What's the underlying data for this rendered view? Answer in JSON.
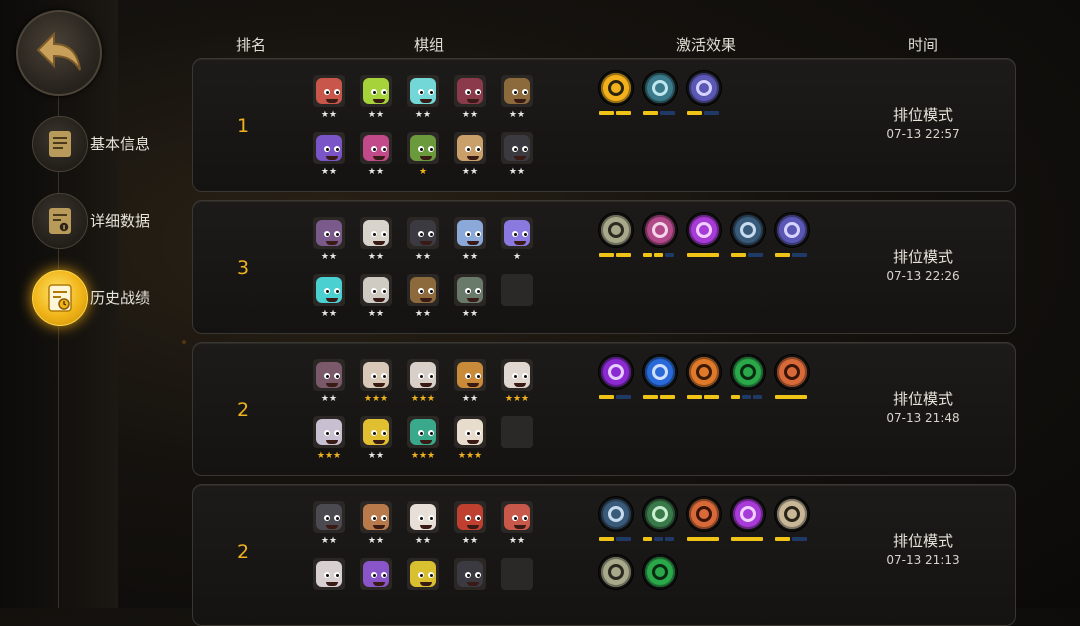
{
  "sidebar": {
    "back_icon": "back-arrow-icon",
    "items": [
      {
        "label": "基本信息",
        "icon": "document-icon",
        "active": false
      },
      {
        "label": "详细数据",
        "icon": "data-sheet-icon",
        "active": false
      },
      {
        "label": "历史战绩",
        "icon": "history-clock-icon",
        "active": true
      }
    ]
  },
  "headers": {
    "rank": "排名",
    "lineup": "棋组",
    "traits": "激活效果",
    "time": "时间"
  },
  "colors": {
    "accent": "#f0b21e",
    "star_gold": "#f0b21e",
    "star_white": "#e6e6e6",
    "bar_on": "#f0c417",
    "bar_off": "#1f3a66"
  },
  "matches": [
    {
      "rank": "1",
      "mode": "排位模式",
      "time": "07-13 22:57",
      "pieces": [
        {
          "color": "#c9564a",
          "stars": "★★",
          "star_color": "white"
        },
        {
          "color": "#a6d23a",
          "stars": "★★",
          "star_color": "white"
        },
        {
          "color": "#72d7d6",
          "stars": "★★",
          "star_color": "white"
        },
        {
          "color": "#8a3a4a",
          "stars": "★★",
          "star_color": "white"
        },
        {
          "color": "#8c6a3c",
          "stars": "★★",
          "star_color": "white"
        },
        {
          "color": "#7a55c8",
          "stars": "★★",
          "star_color": "white"
        },
        {
          "color": "#c24a8a",
          "stars": "★★",
          "star_color": "white"
        },
        {
          "color": "#6a9a3c",
          "stars": "★",
          "star_color": "gold"
        },
        {
          "color": "#c9a06a",
          "stars": "★★",
          "star_color": "white"
        },
        {
          "color": "#3a3a40",
          "stars": "★★",
          "star_color": "white"
        }
      ],
      "traits": [
        {
          "icon": "keyhole-trait-icon",
          "bg": "#f2b01c",
          "fg": "#2a2410",
          "bars": [
            1,
            1
          ]
        },
        {
          "icon": "mystery-trait-icon",
          "bg": "#3a7a8a",
          "fg": "#bfe6ef",
          "bars": [
            1,
            0
          ]
        },
        {
          "icon": "mech-trait-icon",
          "bg": "#5a58b4",
          "fg": "#d6d4ff",
          "bars": [
            1,
            0
          ]
        }
      ]
    },
    {
      "rank": "3",
      "mode": "排位模式",
      "time": "07-13 22:26",
      "pieces": [
        {
          "color": "#7a5a8a",
          "stars": "★★",
          "star_color": "white"
        },
        {
          "color": "#d8d4cc",
          "stars": "★★",
          "star_color": "white"
        },
        {
          "color": "#3a3a40",
          "stars": "★★",
          "star_color": "white"
        },
        {
          "color": "#8aa8d8",
          "stars": "★★",
          "star_color": "white"
        },
        {
          "color": "#8a7ae0",
          "stars": "★",
          "star_color": "white"
        },
        {
          "color": "#4ad0d0",
          "stars": "★★",
          "star_color": "white"
        },
        {
          "color": "#cfcac2",
          "stars": "★★",
          "star_color": "white"
        },
        {
          "color": "#8c6a3c",
          "stars": "★★",
          "star_color": "white"
        },
        {
          "color": "#6a7a6a",
          "stars": "★★",
          "star_color": "white"
        },
        {
          "color": "",
          "stars": "",
          "star_color": "white"
        }
      ],
      "traits": [
        {
          "icon": "beast-trait-icon",
          "bg": "#a8a88a",
          "fg": "#2a2a20",
          "bars": [
            1,
            1
          ]
        },
        {
          "icon": "knight-trait-icon",
          "bg": "#b24a8a",
          "fg": "#f3d6ea",
          "bars": [
            1,
            1,
            0
          ]
        },
        {
          "icon": "demon-trait-icon",
          "bg": "#a83ad8",
          "fg": "#f0d0ff",
          "bars": [
            2
          ]
        },
        {
          "icon": "orb-trait-icon",
          "bg": "#3a5a7a",
          "fg": "#c8dcf0",
          "bars": [
            1,
            0
          ]
        },
        {
          "icon": "mech-trait-icon",
          "bg": "#5a58b4",
          "fg": "#d6d4ff",
          "bars": [
            1,
            0
          ]
        }
      ]
    },
    {
      "rank": "2",
      "mode": "排位模式",
      "time": "07-13 21:48",
      "pieces": [
        {
          "color": "#7a5a6a",
          "stars": "★★",
          "star_color": "white"
        },
        {
          "color": "#d8c8b8",
          "stars": "★★★",
          "star_color": "gold"
        },
        {
          "color": "#d8d0c8",
          "stars": "★★★",
          "star_color": "gold"
        },
        {
          "color": "#c98a3a",
          "stars": "★★",
          "star_color": "white"
        },
        {
          "color": "#e0d8d0",
          "stars": "★★★",
          "star_color": "gold"
        },
        {
          "color": "#c8c0d0",
          "stars": "★★★",
          "star_color": "gold"
        },
        {
          "color": "#e0c030",
          "stars": "★★",
          "star_color": "white"
        },
        {
          "color": "#3aa88a",
          "stars": "★★★",
          "star_color": "gold"
        },
        {
          "color": "#e8dccc",
          "stars": "★★★",
          "star_color": "gold"
        },
        {
          "color": "",
          "stars": "",
          "star_color": "white"
        }
      ],
      "traits": [
        {
          "icon": "goblin-trait-icon",
          "bg": "#8a2ad0",
          "fg": "#e6ccff",
          "bars": [
            1,
            0
          ]
        },
        {
          "icon": "feather-trait-icon",
          "bg": "#2a6ad8",
          "fg": "#cfe0ff",
          "bars": [
            1,
            1
          ]
        },
        {
          "icon": "flame-trait-icon",
          "bg": "#e07a2a",
          "fg": "#3a1a08",
          "bars": [
            1,
            1
          ]
        },
        {
          "icon": "paw-trait-icon",
          "bg": "#2aa84a",
          "fg": "#0a2a12",
          "bars": [
            1,
            0,
            0
          ]
        },
        {
          "icon": "fox-trait-icon",
          "bg": "#d86a3a",
          "fg": "#3a1408",
          "bars": [
            2
          ]
        }
      ]
    },
    {
      "rank": "2",
      "mode": "排位模式",
      "time": "07-13 21:13",
      "pieces": [
        {
          "color": "#4a4a50",
          "stars": "★★",
          "star_color": "white"
        },
        {
          "color": "#b87a4a",
          "stars": "★★",
          "star_color": "white"
        },
        {
          "color": "#e8e0d8",
          "stars": "★★",
          "star_color": "white"
        },
        {
          "color": "#c04030",
          "stars": "★★",
          "star_color": "white"
        },
        {
          "color": "#c8584a",
          "stars": "★★",
          "star_color": "white"
        },
        {
          "color": "#d8d0d0",
          "stars": "",
          "star_color": "white"
        },
        {
          "color": "#8a55c8",
          "stars": "",
          "star_color": "white"
        },
        {
          "color": "#d8c030",
          "stars": "",
          "star_color": "white"
        },
        {
          "color": "#3a3a40",
          "stars": "",
          "star_color": "white"
        },
        {
          "color": "",
          "stars": "",
          "star_color": "white"
        }
      ],
      "traits": [
        {
          "icon": "orb-trait-icon",
          "bg": "#3a5a7a",
          "fg": "#c8dcf0",
          "bars": [
            1,
            0
          ]
        },
        {
          "icon": "bow-trait-icon",
          "bg": "#3a7a4a",
          "fg": "#c8f0d0",
          "bars": [
            1,
            0,
            0
          ]
        },
        {
          "icon": "fox-trait-icon",
          "bg": "#d86a3a",
          "fg": "#3a1408",
          "bars": [
            2
          ]
        },
        {
          "icon": "demon-trait-icon",
          "bg": "#a83ad8",
          "fg": "#f0d0ff",
          "bars": [
            2
          ]
        },
        {
          "icon": "axe-trait-icon",
          "bg": "#c8b898",
          "fg": "#2a2418",
          "bars": [
            1,
            0
          ]
        },
        {
          "icon": "beast-trait-icon",
          "bg": "#a8a88a",
          "fg": "#2a2a20",
          "bars": []
        },
        {
          "icon": "paw-trait-icon",
          "bg": "#2aa84a",
          "fg": "#0a2a12",
          "bars": []
        }
      ]
    }
  ]
}
